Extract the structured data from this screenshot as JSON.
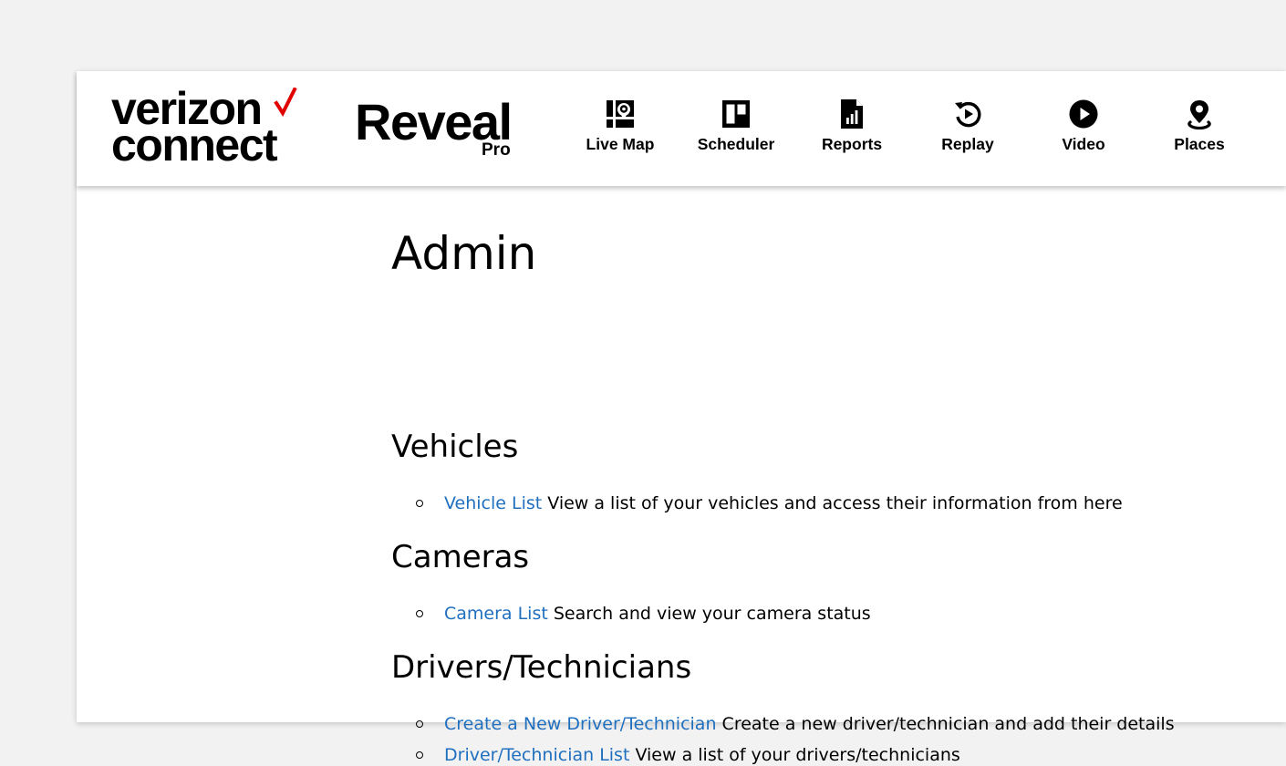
{
  "brand": {
    "company_line1": "verizon",
    "company_line2": "connect",
    "product_name": "Reveal",
    "product_tier": "Pro",
    "accent_color": "#e00000",
    "link_color": "#1f6fbf"
  },
  "nav": {
    "items": [
      {
        "label": "Live Map",
        "icon": "map-pin-icon"
      },
      {
        "label": "Scheduler",
        "icon": "scheduler-icon"
      },
      {
        "label": "Reports",
        "icon": "report-document-icon"
      },
      {
        "label": "Replay",
        "icon": "replay-icon"
      },
      {
        "label": "Video",
        "icon": "play-icon"
      },
      {
        "label": "Places",
        "icon": "location-pin-icon"
      }
    ]
  },
  "page": {
    "title": "Admin",
    "sections": [
      {
        "title": "Vehicles",
        "items": [
          {
            "link": "Vehicle List",
            "description": "View a list of your vehicles and access their information from here"
          }
        ]
      },
      {
        "title": "Cameras",
        "items": [
          {
            "link": "Camera List",
            "description": "Search and view your camera status"
          }
        ]
      },
      {
        "title": "Drivers/Technicians",
        "items": [
          {
            "link": "Create a New Driver/Technician",
            "description": "Create a new driver/technician and add their details"
          },
          {
            "link": "Driver/Technician List",
            "description": "View a list of your drivers/technicians"
          }
        ]
      }
    ]
  }
}
